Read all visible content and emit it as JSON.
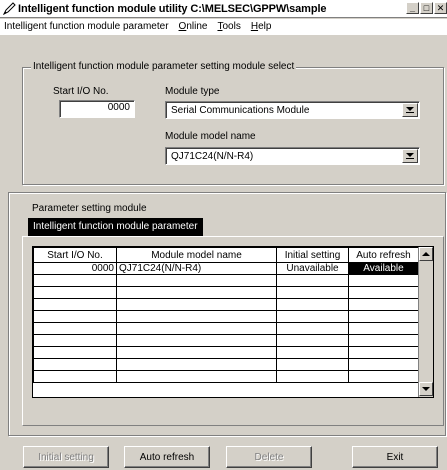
{
  "window": {
    "title": "Intelligent function module utility C:\\MELSEC\\GPPW\\sample",
    "minimize_glyph": "_",
    "maximize_glyph": "□",
    "close_glyph": "✕"
  },
  "menu": {
    "items": [
      {
        "label": "Intelligent function module parameter"
      },
      {
        "label": "Online",
        "accel": "O",
        "rest": "nline"
      },
      {
        "label": "Tools",
        "accel": "T",
        "rest": "ools"
      },
      {
        "label": "Help",
        "accel": "H",
        "rest": "elp"
      }
    ]
  },
  "select_group": {
    "title": "Intelligent function module parameter setting module select",
    "start_io_label": "Start I/O No.",
    "start_io_value": "0000",
    "module_type_label": "Module type",
    "module_type_value": "Serial Communications Module",
    "module_model_label": "Module model name",
    "module_model_value": "QJ71C24(N/N-R4)"
  },
  "param_group": {
    "title": "Parameter setting module",
    "tab_label": "Intelligent function module parameter",
    "columns": [
      "Start I/O No.",
      "Module model name",
      "Initial setting",
      "Auto refresh"
    ],
    "rows": [
      {
        "io": "0000",
        "model": "QJ71C24(N/N-R4)",
        "initial": "Unavailable",
        "auto": "Available"
      },
      {
        "io": "",
        "model": "",
        "initial": "",
        "auto": ""
      },
      {
        "io": "",
        "model": "",
        "initial": "",
        "auto": ""
      },
      {
        "io": "",
        "model": "",
        "initial": "",
        "auto": ""
      },
      {
        "io": "",
        "model": "",
        "initial": "",
        "auto": ""
      },
      {
        "io": "",
        "model": "",
        "initial": "",
        "auto": ""
      },
      {
        "io": "",
        "model": "",
        "initial": "",
        "auto": ""
      },
      {
        "io": "",
        "model": "",
        "initial": "",
        "auto": ""
      },
      {
        "io": "",
        "model": "",
        "initial": "",
        "auto": ""
      },
      {
        "io": "",
        "model": "",
        "initial": "",
        "auto": ""
      }
    ]
  },
  "buttons": {
    "initial_setting": "Initial setting",
    "auto_refresh": "Auto refresh",
    "delete": "Delete",
    "exit": "Exit"
  },
  "icons": {
    "app": "pen-icon",
    "dropdown": "chevron-down-icon",
    "scroll_up": "triangle-up-icon",
    "scroll_down": "triangle-down-icon"
  }
}
